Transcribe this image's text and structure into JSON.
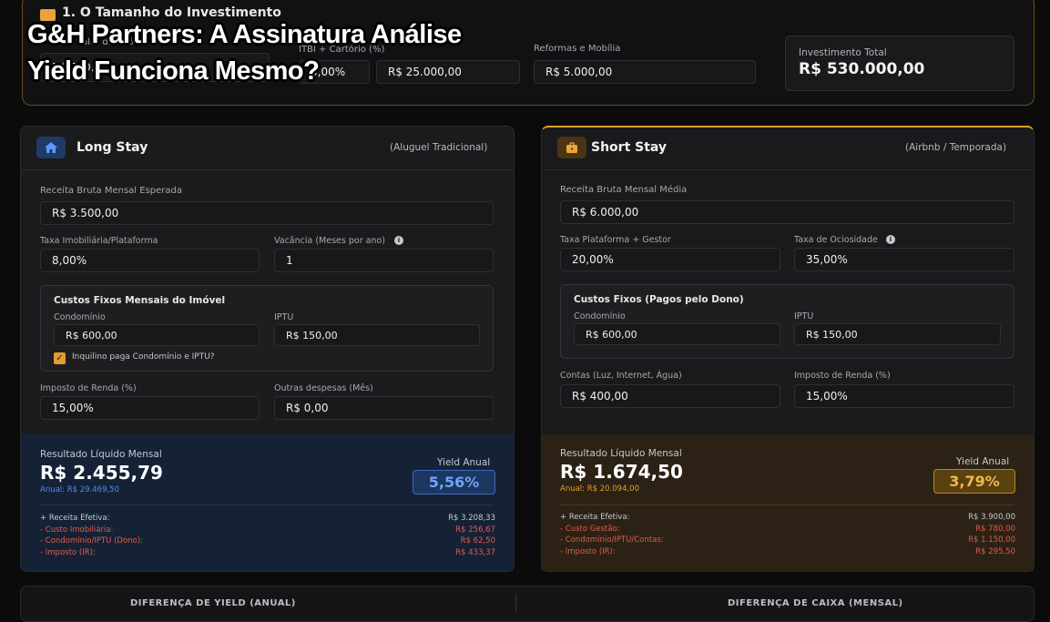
{
  "headline": {
    "line1": "G&H Partners: A Assinatura Análise",
    "line2": "Yield Funciona Mesmo?"
  },
  "investment": {
    "title": "1. O Tamanho do Investimento",
    "fields": [
      {
        "label": "Valor do Imóvel",
        "value": "R$ 500.000,00"
      },
      {
        "label": "ITBI + Cartório (%)",
        "value": "5,00%"
      },
      {
        "value": "R$ 25.000,00"
      },
      {
        "label": "Reformas e Mobília",
        "value": "R$ 5.000,00"
      }
    ],
    "total_label": "Investimento Total",
    "total_value": "R$ 530.000,00"
  },
  "long_stay": {
    "title": "Long Stay",
    "subtitle": "(Aluguel Tradicional)",
    "gross_label": "Receita Bruta Mensal Esperada",
    "gross_value": "R$ 3.500,00",
    "fee_label": "Taxa Imobiliária/Plataforma",
    "fee_value": "8,00%",
    "vacancy_label": "Vacância (Meses por ano)",
    "vacancy_value": "1",
    "fixed_title": "Custos Fixos Mensais do Imóvel",
    "condo_label": "Condomínio",
    "condo_value": "R$ 600,00",
    "iptu_label": "IPTU",
    "iptu_value": "R$ 150,00",
    "tenant_pays_label": "Inquilino paga Condomínio e IPTU?",
    "tax_label": "Imposto de Renda (%)",
    "tax_value": "15,00%",
    "other_label": "Outras despesas (Mês)",
    "other_value": "R$ 0,00",
    "result_label": "Resultado Líquido Mensal",
    "result_value": "R$ 2.455,79",
    "annual": "Anual: R$ 29.469,50",
    "yield_label": "Yield Anual",
    "yield_value": "5,56%",
    "breakdown": [
      {
        "label": "+ Receita Efetiva:",
        "value": "R$ 3.208,33"
      },
      {
        "label": "- Custo Imobiliária:",
        "value": "R$ 256,67"
      },
      {
        "label": "- Condomínio/IPTU (Dono):",
        "value": "R$ 62,50"
      },
      {
        "label": "- Imposto (IR):",
        "value": "R$ 433,37"
      }
    ]
  },
  "short_stay": {
    "title": "Short Stay",
    "subtitle": "(Airbnb / Temporada)",
    "gross_label": "Receita Bruta Mensal Média",
    "gross_value": "R$ 6.000,00",
    "fee_label": "Taxa Plataforma + Gestor",
    "fee_value": "20,00%",
    "idle_label": "Taxa de Ociosidade",
    "idle_value": "35,00%",
    "fixed_title": "Custos Fixos (Pagos pelo Dono)",
    "condo_label": "Condomínio",
    "condo_value": "R$ 600,00",
    "iptu_label": "IPTU",
    "iptu_value": "R$ 150,00",
    "bills_label": "Contas (Luz, Internet, Água)",
    "bills_value": "R$ 400,00",
    "tax_label": "Imposto de Renda (%)",
    "tax_value": "15,00%",
    "result_label": "Resultado Líquido Mensal",
    "result_value": "R$ 1.674,50",
    "annual": "Anual: R$ 20.094,00",
    "yield_label": "Yield Anual",
    "yield_value": "3,79%",
    "breakdown": [
      {
        "label": "+ Receita Efetiva:",
        "value": "R$ 3.900,00"
      },
      {
        "label": "- Custo Gestão:",
        "value": "R$ 780,00"
      },
      {
        "label": "- Condomínio/IPTU/Contas:",
        "value": "R$ 1.150,00"
      },
      {
        "label": "- Imposto (IR):",
        "value": "R$ 295,50"
      }
    ]
  },
  "bottom": {
    "yield_diff": "DIFERENÇA DE YIELD (ANUAL)",
    "cash_diff": "DIFERENÇA DE CAIXA (MENSAL)"
  },
  "colors": {
    "accent_orange": "#e79c2a",
    "accent_blue": "#4f8ef0",
    "negative": "#e25b4a"
  }
}
